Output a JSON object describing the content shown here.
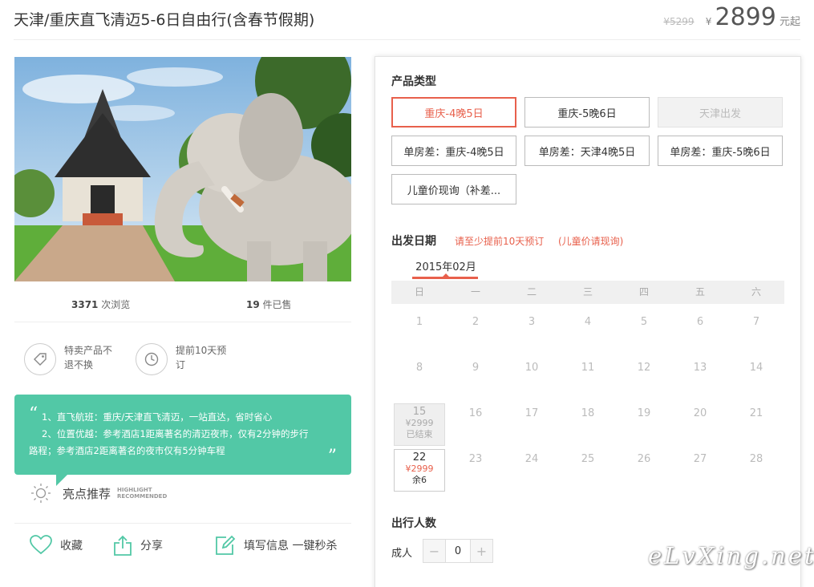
{
  "header": {
    "title": "天津/重庆直飞清迈5-6日自由行(含春节假期)",
    "old_price": "¥5299",
    "currency": "¥",
    "price": "2899",
    "price_suffix": "元起"
  },
  "stats": {
    "views_count": "3371",
    "views_label": "次浏览",
    "sold_count": "19",
    "sold_label": "件已售"
  },
  "policies": [
    {
      "icon": "tag-icon",
      "text": "特卖产品不退不换"
    },
    {
      "icon": "clock-icon",
      "text": "提前10天预订"
    }
  ],
  "highlight": {
    "line1": "1、直飞航班：重庆/天津直飞清迈，一站直达，省时省心",
    "line2": "2、位置优越：参考酒店1距离著名的清迈夜市，仅有2分钟的步行",
    "line3": "路程；参考酒店2距离著名的夜市仅有5分钟车程",
    "open_quote": "“",
    "close_quote": "”",
    "caption": "亮点推荐",
    "caption_en_1": "HIGHLIGHT",
    "caption_en_2": "RECOMMENDED"
  },
  "actions": {
    "favorite": "收藏",
    "share": "分享",
    "fill_info": "填写信息 一键秒杀"
  },
  "product_type": {
    "title": "产品类型",
    "options": [
      {
        "label": "重庆-4晚5日",
        "state": "selected"
      },
      {
        "label": "重庆-5晚6日",
        "state": "normal"
      },
      {
        "label": "天津出发",
        "state": "disabled"
      },
      {
        "label": "单房差：重庆-4晚5日",
        "state": "normal"
      },
      {
        "label": "单房差：天津4晚5日",
        "state": "normal"
      },
      {
        "label": "单房差：重庆-5晚6日",
        "state": "normal"
      },
      {
        "label": "儿童价现询（补差...",
        "state": "normal"
      }
    ]
  },
  "departure": {
    "title": "出发日期",
    "note1": "请至少提前10天预订",
    "note2": "(儿童价请现询)",
    "month": "2015年02月",
    "weekdays": [
      "日",
      "一",
      "二",
      "三",
      "四",
      "五",
      "六"
    ],
    "days": [
      {
        "d": "1"
      },
      {
        "d": "2"
      },
      {
        "d": "3"
      },
      {
        "d": "4"
      },
      {
        "d": "5"
      },
      {
        "d": "6"
      },
      {
        "d": "7"
      },
      {
        "d": "8"
      },
      {
        "d": "9"
      },
      {
        "d": "10"
      },
      {
        "d": "11"
      },
      {
        "d": "12"
      },
      {
        "d": "13"
      },
      {
        "d": "14"
      },
      {
        "d": "15",
        "price": "¥2999",
        "status": "已结束",
        "state": "ended"
      },
      {
        "d": "16"
      },
      {
        "d": "17"
      },
      {
        "d": "18"
      },
      {
        "d": "19"
      },
      {
        "d": "20"
      },
      {
        "d": "21"
      },
      {
        "d": "22",
        "price": "¥2999",
        "status": "余6",
        "state": "available"
      },
      {
        "d": "23"
      },
      {
        "d": "24"
      },
      {
        "d": "25"
      },
      {
        "d": "26"
      },
      {
        "d": "27"
      },
      {
        "d": "28"
      }
    ]
  },
  "travelers": {
    "title": "出行人数",
    "adult_label": "成人",
    "minus": "−",
    "plus": "+",
    "adult_count": "0"
  },
  "watermark": "eLvXing.net",
  "colors": {
    "accent": "#e8604c",
    "highlight_bg": "#52c8a6"
  }
}
